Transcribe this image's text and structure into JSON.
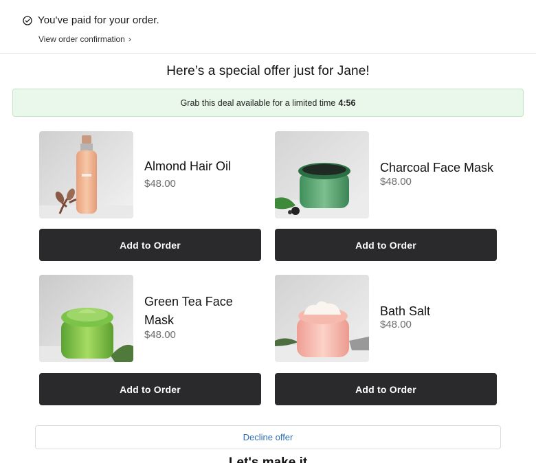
{
  "status": {
    "message": "You've paid for your order.",
    "link_label": "View order confirmation"
  },
  "offer": {
    "heading": "Here’s a special offer just for Jane!",
    "timer_text": "Grab this deal available for a limited time",
    "timer_value": "4:56"
  },
  "products": [
    {
      "name": "Almond Hair Oil",
      "price": "$48.00",
      "button": "Add to Order"
    },
    {
      "name": "Charcoal Face Mask",
      "price": "$48.00",
      "button": "Add to Order"
    },
    {
      "name": "Green Tea Face Mask",
      "price": "$48.00",
      "button": "Add to Order"
    },
    {
      "name": "Bath Salt",
      "price": "$48.00",
      "button": "Add to Order"
    }
  ],
  "decline_label": "Decline offer",
  "next_section_heading": "Let's make it",
  "colors": {
    "button_dark": "#2a2a2d",
    "timer_bg": "#e9f8ea",
    "link_blue": "#2f6fb3"
  },
  "icons": {
    "status": "check-circle-icon",
    "link": "chevron-right-icon"
  }
}
